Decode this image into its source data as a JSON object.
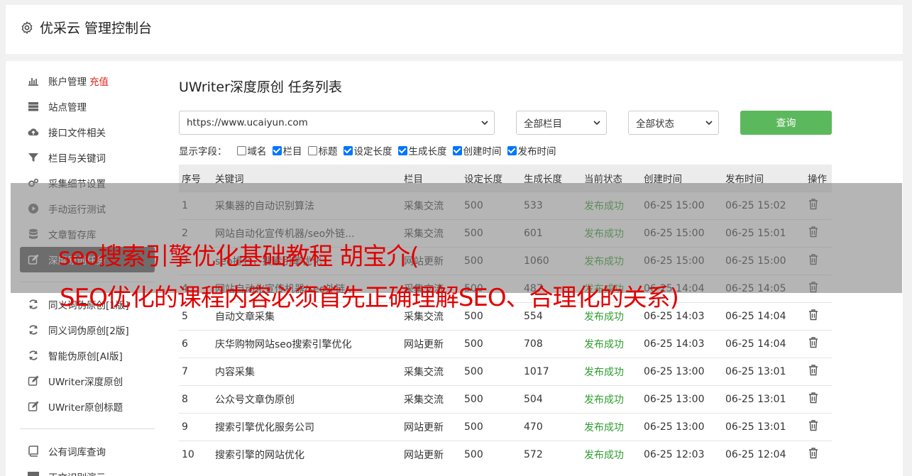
{
  "header": {
    "title": "优采云 管理控制台",
    "icon": "gear-icon"
  },
  "sidebar": {
    "group1": [
      {
        "label": "账户管理",
        "badge": "充值",
        "icon": "bar-chart-icon"
      },
      {
        "label": "站点管理",
        "icon": "server-icon"
      },
      {
        "label": "接口文件相关",
        "icon": "cloud-upload-icon"
      },
      {
        "label": "栏目与关键词",
        "icon": "filter-icon"
      },
      {
        "label": "采集细节设置",
        "icon": "cogs-icon"
      },
      {
        "label": "手动运行测试",
        "icon": "play-circle-icon"
      },
      {
        "label": "文章暂存库",
        "icon": "database-icon"
      },
      {
        "label": "深度原创任务",
        "icon": "edit-icon",
        "active": true
      }
    ],
    "group2": [
      {
        "label": "同义词伪原创[1版]",
        "icon": "refresh-icon"
      },
      {
        "label": "同义词伪原创[2版]",
        "icon": "refresh-icon"
      },
      {
        "label": "智能伪原创[AI版]",
        "icon": "refresh-icon"
      },
      {
        "label": "UWriter深度原创",
        "icon": "edit-icon"
      },
      {
        "label": "UWriter原创标题",
        "icon": "edit-icon"
      }
    ],
    "group3": [
      {
        "label": "公有词库查询",
        "icon": "book-icon"
      },
      {
        "label": "正文识别演示",
        "icon": "monitor-icon"
      }
    ]
  },
  "main": {
    "title": "UWriter深度原创 任务列表",
    "filters": {
      "site": "https://www.ucaiyun.com",
      "column": "全部栏目",
      "status": "全部状态",
      "query_label": "查询"
    },
    "fields_label": "显示字段：",
    "fields": [
      {
        "label": "域名",
        "checked": false
      },
      {
        "label": "栏目",
        "checked": true
      },
      {
        "label": "标题",
        "checked": false
      },
      {
        "label": "设定长度",
        "checked": true
      },
      {
        "label": "生成长度",
        "checked": true
      },
      {
        "label": "创建时间",
        "checked": true
      },
      {
        "label": "发布时间",
        "checked": true
      }
    ],
    "table": {
      "headers": [
        "序号",
        "关键词",
        "栏目",
        "设定长度",
        "生成长度",
        "当前状态",
        "创建时间",
        "发布时间",
        "操作"
      ],
      "rows": [
        [
          "1",
          "采集器的自动识别算法",
          "采集交流",
          "500",
          "533",
          "发布成功",
          "06-25 15:00",
          "06-25 15:02"
        ],
        [
          "2",
          "网站自动化宣传机器/seo外链...",
          "采集交流",
          "500",
          "601",
          "发布成功",
          "06-25 15:00",
          "06-25 15:01"
        ],
        [
          "3",
          "seo排名，搜索引擎优化",
          "网站更新",
          "500",
          "1060",
          "发布成功",
          "06-25 15:00",
          "06-25 15:00"
        ],
        [
          "4",
          "网站自动化宣传机器/seo外链...",
          "采集交流",
          "500",
          "487",
          "发布成功",
          "06-25 14:04",
          "06-25 14:05"
        ],
        [
          "5",
          "自动文章采集",
          "采集交流",
          "500",
          "554",
          "发布成功",
          "06-25 14:03",
          "06-25 14:04"
        ],
        [
          "6",
          "庆华购物网站seo搜索引擎优化",
          "网站更新",
          "500",
          "708",
          "发布成功",
          "06-25 14:03",
          "06-25 14:04"
        ],
        [
          "7",
          "内容采集",
          "采集交流",
          "500",
          "1017",
          "发布成功",
          "06-25 13:00",
          "06-25 13:01"
        ],
        [
          "8",
          "公众号文章伪原创",
          "采集交流",
          "500",
          "504",
          "发布成功",
          "06-25 13:00",
          "06-25 13:01"
        ],
        [
          "9",
          "搜索引擎优化服务公司",
          "网站更新",
          "500",
          "470",
          "发布成功",
          "06-25 13:00",
          "06-25 13:01"
        ],
        [
          "10",
          "搜索引擎的网站优化",
          "网站更新",
          "500",
          "572",
          "发布成功",
          "06-25 12:03",
          "06-25 12:04"
        ]
      ]
    }
  },
  "overlay": {
    "line1": "seo搜索引擎优化基础教程 胡宝介(",
    "line2": "SEO优化的课程内容必须首先正确理解SEO、合理化的关系)"
  },
  "colors": {
    "accent_green": "#5cb85c",
    "success_text": "#2e9e2e",
    "badge_red": "#e1251b",
    "overlay_text": "#e10000",
    "active_nav": "#555555"
  }
}
